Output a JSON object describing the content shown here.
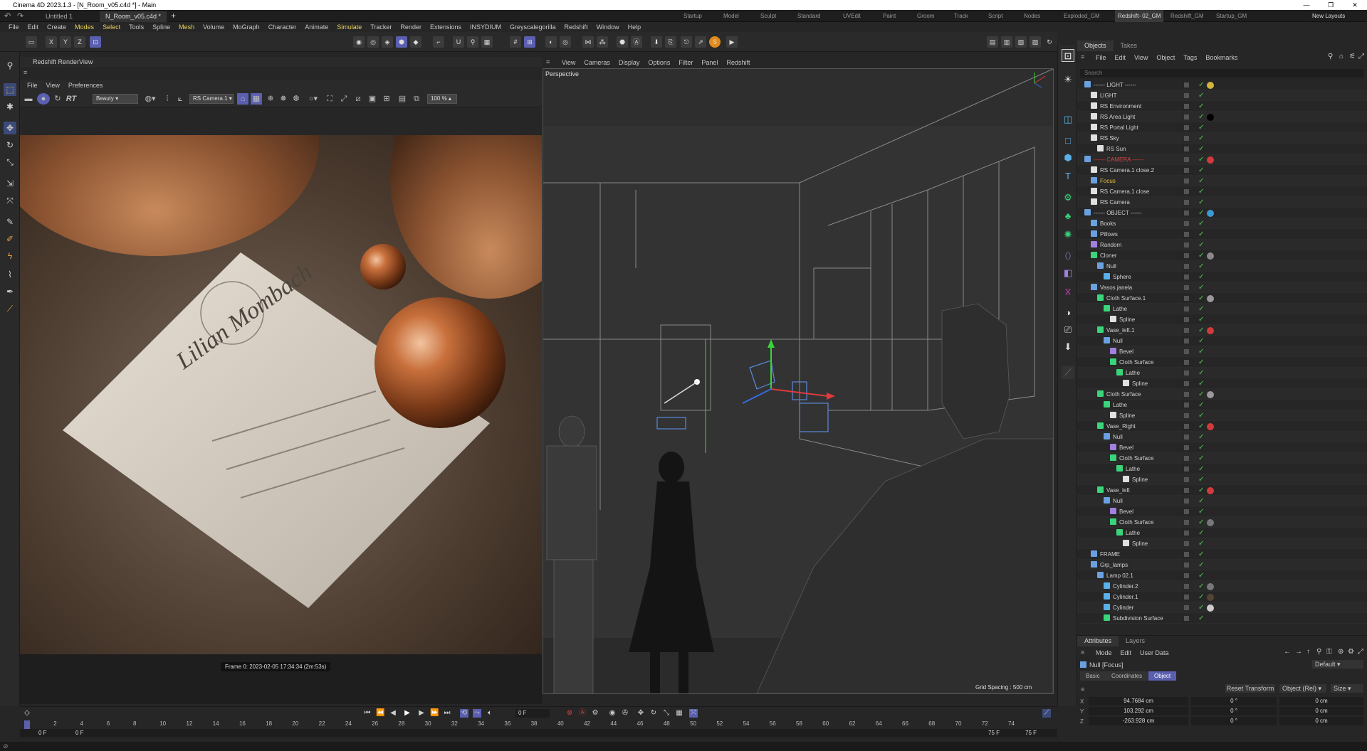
{
  "window": {
    "title": "Cinema 4D 2023.1.3 - [N_Room_v05.c4d *] - Main",
    "controls": [
      "—",
      "❐",
      "✕"
    ]
  },
  "doc_tabs": [
    {
      "label": "Untitled 1",
      "active": false
    },
    {
      "label": "N_Room_v05.c4d *",
      "active": true
    }
  ],
  "layout_tabs": [
    {
      "label": "Startup"
    },
    {
      "label": "Model"
    },
    {
      "label": "Sculpt"
    },
    {
      "label": "Standard"
    },
    {
      "label": "UVEdit"
    },
    {
      "label": "Paint"
    },
    {
      "label": "Groom"
    },
    {
      "label": "Track"
    },
    {
      "label": "Script"
    },
    {
      "label": "Nodes"
    },
    {
      "label": "Exploded_GM"
    },
    {
      "label": "Redshift- 02_GM",
      "active": true
    },
    {
      "label": "Redshift_GM"
    },
    {
      "label": "Startup_GM"
    }
  ],
  "new_layouts": "New Layouts",
  "menu": [
    "File",
    "Edit",
    "Create",
    "Modes",
    "Select",
    "Tools",
    "Spline",
    "Mesh",
    "Volume",
    "MoGraph",
    "Character",
    "Animate",
    "Simulate",
    "Tracker",
    "Render",
    "Extensions",
    "INSYDIUM",
    "Greyscalegorilla",
    "Redshift",
    "Window",
    "Help"
  ],
  "toolbar": {
    "axes": [
      "X",
      "Y",
      "Z"
    ]
  },
  "renderview": {
    "title": "Redshift RenderView",
    "menu": [
      "File",
      "View",
      "Preferences"
    ],
    "rt_label": "RT",
    "aov": "Beauty",
    "camera": "RS Camera.1",
    "zoom": "100 %",
    "status": "Frame  0:  2023-02-05  17:34:34  (2m:53s)",
    "card_text": "Lilian Mombach",
    "colors": {
      "bg": "#3a2a1e",
      "card": "#d8d0c4",
      "copper": "#b8683a"
    }
  },
  "viewport": {
    "menu": [
      "View",
      "Cameras",
      "Display",
      "Options",
      "Filter",
      "Panel",
      "Redshift"
    ],
    "label": "Perspective",
    "grid_spacing": "Grid Spacing : 500 cm"
  },
  "objects_panel": {
    "tabs": [
      "Objects",
      "Takes"
    ],
    "menu": [
      "File",
      "Edit",
      "View",
      "Object",
      "Tags",
      "Bookmarks"
    ],
    "search_placeholder": "Search",
    "rows": [
      {
        "name": "------ LIGHT ------",
        "depth": 0,
        "icon": "null",
        "tag": "#d4b43a"
      },
      {
        "name": "LIGHT",
        "depth": 1,
        "icon": "light"
      },
      {
        "name": "RS Environment",
        "depth": 1,
        "icon": "light"
      },
      {
        "name": "RS Area Light",
        "depth": 1,
        "icon": "light",
        "tag": "#000000"
      },
      {
        "name": "RS Portal Light",
        "depth": 1,
        "icon": "light"
      },
      {
        "name": "RS Sky",
        "depth": 1,
        "icon": "light"
      },
      {
        "name": "RS Sun",
        "depth": 2,
        "icon": "light"
      },
      {
        "name": "------ CAMERA ------",
        "depth": 0,
        "icon": "null",
        "color": "#d44",
        "tag": "#d43a3a"
      },
      {
        "name": "RS Camera.1 close.2",
        "depth": 1,
        "icon": "camera"
      },
      {
        "name": "Focus",
        "depth": 1,
        "icon": "null",
        "color": "#e8c040"
      },
      {
        "name": "RS Camera.1 close",
        "depth": 1,
        "icon": "camera"
      },
      {
        "name": "RS Camera",
        "depth": 1,
        "icon": "camera"
      },
      {
        "name": "------ OBJECT ------",
        "depth": 0,
        "icon": "null",
        "tag": "#3a9ad4"
      },
      {
        "name": "Books",
        "depth": 1,
        "icon": "null"
      },
      {
        "name": "Pillows",
        "depth": 1,
        "icon": "null"
      },
      {
        "name": "Random",
        "depth": 1,
        "icon": "effector"
      },
      {
        "name": "Cloner",
        "depth": 1,
        "icon": "cloner",
        "tag": "#888888"
      },
      {
        "name": "Null",
        "depth": 2,
        "icon": "null"
      },
      {
        "name": "Sphere",
        "depth": 3,
        "icon": "sphere"
      },
      {
        "name": "Vasos janela",
        "depth": 1,
        "icon": "null"
      },
      {
        "name": "Cloth Surface.1",
        "depth": 2,
        "icon": "cloth",
        "tag": "#999999"
      },
      {
        "name": "Lathe",
        "depth": 3,
        "icon": "lathe"
      },
      {
        "name": "Spline",
        "depth": 4,
        "icon": "spline"
      },
      {
        "name": "Vase_left.1",
        "depth": 2,
        "icon": "cloner",
        "tag": "#d43a3a"
      },
      {
        "name": "Null",
        "depth": 3,
        "icon": "null"
      },
      {
        "name": "Bevel",
        "depth": 4,
        "icon": "bevel"
      },
      {
        "name": "Cloth Surface",
        "depth": 4,
        "icon": "cloth"
      },
      {
        "name": "Lathe",
        "depth": 5,
        "icon": "lathe"
      },
      {
        "name": "Spline",
        "depth": 6,
        "icon": "spline"
      },
      {
        "name": "Cloth Surface",
        "depth": 2,
        "icon": "cloth",
        "tag": "#999999"
      },
      {
        "name": "Lathe",
        "depth": 3,
        "icon": "lathe"
      },
      {
        "name": "Spline",
        "depth": 4,
        "icon": "spline"
      },
      {
        "name": "Vase_Right",
        "depth": 2,
        "icon": "cloner",
        "tag": "#d43a3a"
      },
      {
        "name": "Null",
        "depth": 3,
        "icon": "null"
      },
      {
        "name": "Bevel",
        "depth": 4,
        "icon": "bevel"
      },
      {
        "name": "Cloth Surface",
        "depth": 4,
        "icon": "cloth"
      },
      {
        "name": "Lathe",
        "depth": 5,
        "icon": "lathe"
      },
      {
        "name": "Spline",
        "depth": 6,
        "icon": "spline"
      },
      {
        "name": "Vase_left",
        "depth": 2,
        "icon": "cloner",
        "tag": "#d43a3a"
      },
      {
        "name": "Null",
        "depth": 3,
        "icon": "null"
      },
      {
        "name": "Bevel",
        "depth": 4,
        "icon": "bevel"
      },
      {
        "name": "Cloth Surface",
        "depth": 4,
        "icon": "cloth",
        "tag": "#777777"
      },
      {
        "name": "Lathe",
        "depth": 5,
        "icon": "lathe"
      },
      {
        "name": "Spline",
        "depth": 6,
        "icon": "spline"
      },
      {
        "name": "FRAME",
        "depth": 1,
        "icon": "null"
      },
      {
        "name": "Grp_lamps",
        "depth": 1,
        "icon": "null"
      },
      {
        "name": "Lamp 02.1",
        "depth": 2,
        "icon": "null"
      },
      {
        "name": "Cylinder.2",
        "depth": 3,
        "icon": "sphere",
        "tag": "#777777"
      },
      {
        "name": "Cylinder.1",
        "depth": 3,
        "icon": "sphere",
        "tag": "#554433"
      },
      {
        "name": "Cylinder",
        "depth": 3,
        "icon": "sphere",
        "tag": "#cccccc"
      },
      {
        "name": "Subdivision Surface",
        "depth": 3,
        "icon": "cloner"
      }
    ]
  },
  "attributes": {
    "tabs": [
      "Attributes",
      "Layers"
    ],
    "menu": [
      "Mode",
      "Edit",
      "User Data"
    ],
    "object_label": "Null [Focus]",
    "preset": "Default",
    "sub_tabs": [
      {
        "label": "Basic"
      },
      {
        "label": "Coordinates"
      },
      {
        "label": "Object",
        "active": true
      }
    ],
    "reset_transform": "Reset Transform",
    "coord_mode": "Object (Rel)",
    "size_label": "Size",
    "rows": [
      {
        "axis": "X",
        "pos": "94.7684 cm",
        "rot": "0 °",
        "size": "0 cm"
      },
      {
        "axis": "Y",
        "pos": "103.292 cm",
        "rot": "0 °",
        "size": "0 cm"
      },
      {
        "axis": "Z",
        "pos": "-263.928 cm",
        "rot": "0 °",
        "size": "0 cm"
      }
    ]
  },
  "timeline": {
    "current_frame": "0 F",
    "start": "0 F",
    "start2": "0 F",
    "end": "75 F",
    "end2": "75 F",
    "ticks": [
      "0",
      "2",
      "4",
      "6",
      "8",
      "10",
      "12",
      "14",
      "16",
      "18",
      "20",
      "22",
      "24",
      "26",
      "28",
      "30",
      "32",
      "34",
      "36",
      "38",
      "40",
      "42",
      "44",
      "46",
      "48",
      "50",
      "52",
      "54",
      "56",
      "58",
      "60",
      "62",
      "64",
      "66",
      "68",
      "70",
      "72",
      "74"
    ]
  }
}
